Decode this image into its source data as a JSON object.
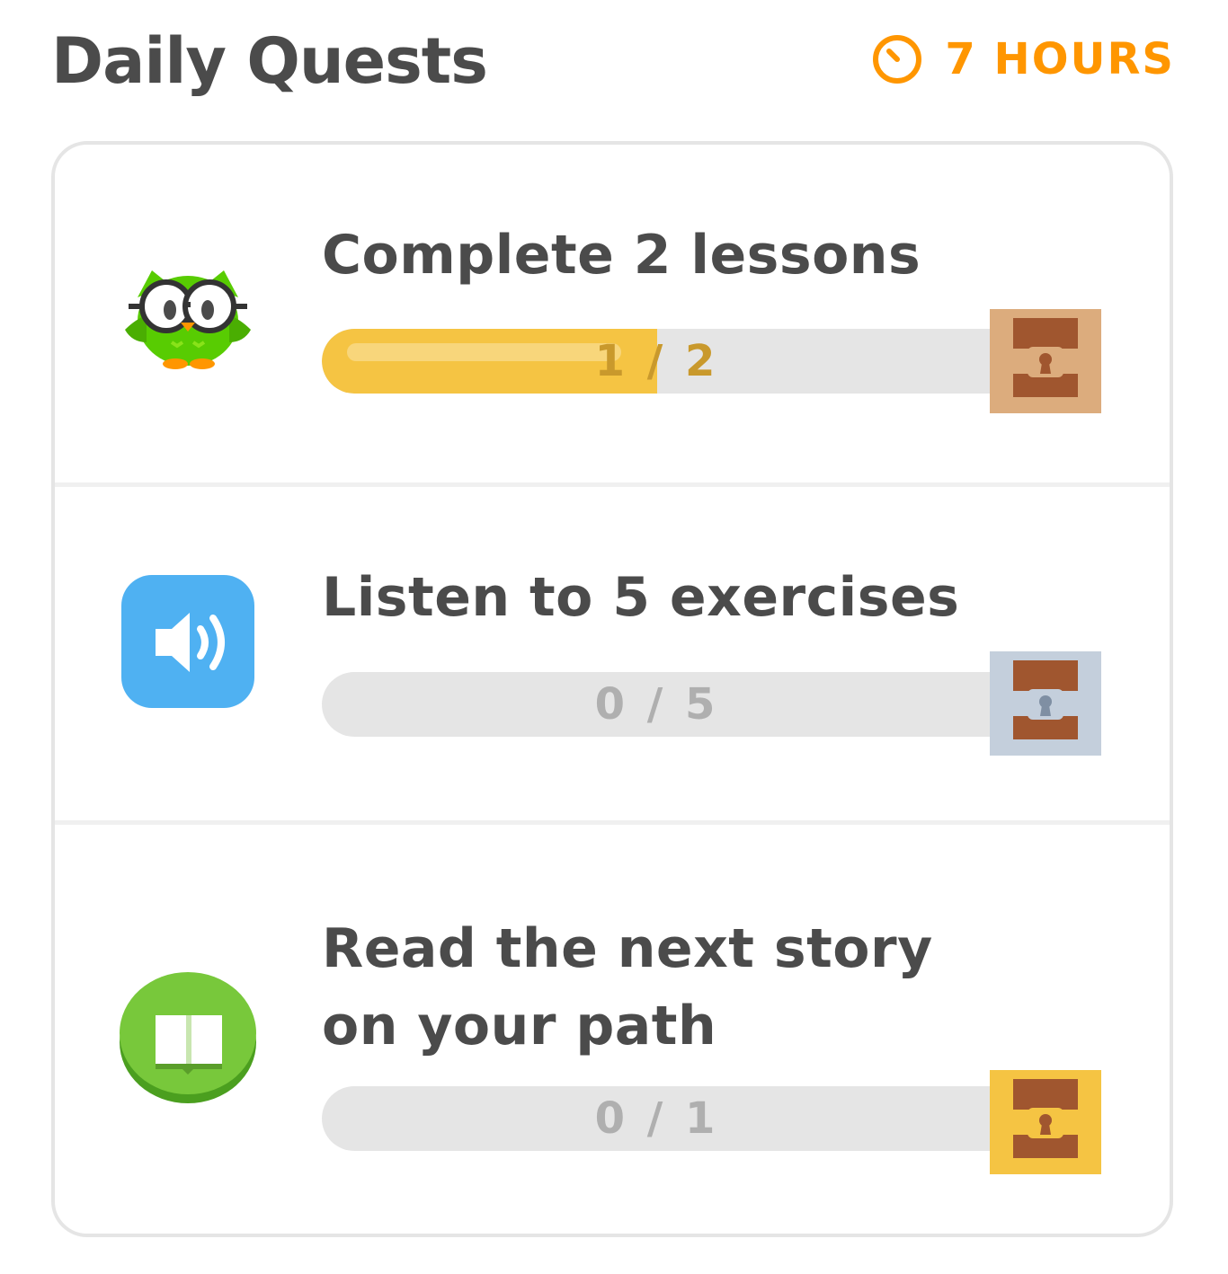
{
  "header": {
    "title": "Daily Quests",
    "timer_label": "7 HOURS",
    "timer_icon": "clock-icon"
  },
  "colors": {
    "accent_orange": "#ff9600",
    "progress_fill": "#f5c443",
    "progress_track": "#e5e5e5",
    "owl_green": "#58cc02",
    "sound_blue": "#49c0f8"
  },
  "quests": [
    {
      "title": "Complete 2 lessons",
      "progress_text": "1 / 2",
      "progress_fraction": 0.5,
      "icon": "duo-owl-icon",
      "reward": "bronze-chest-icon"
    },
    {
      "title": "Listen to 5 exercises",
      "progress_text": "0 / 5",
      "progress_fraction": 0,
      "icon": "speaker-icon",
      "reward": "silver-chest-icon"
    },
    {
      "title": "Read the next story on your path",
      "progress_text": "0 / 1",
      "progress_fraction": 0,
      "icon": "book-icon",
      "reward": "gold-chest-icon"
    }
  ]
}
